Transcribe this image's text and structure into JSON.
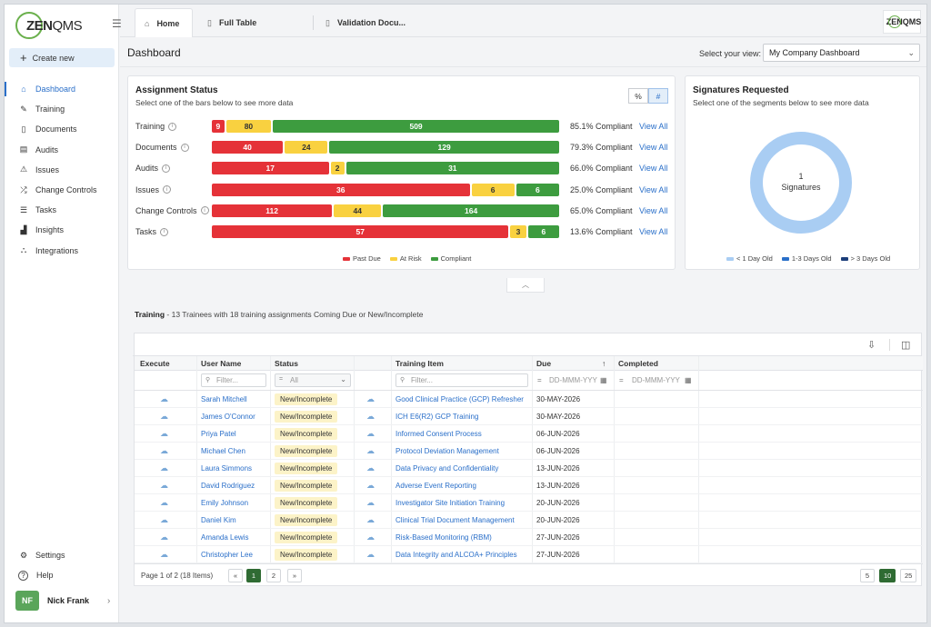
{
  "brand": {
    "logo_text_a": "ZEN",
    "logo_text_b": "QMS",
    "corner_logo": "ZENQMS"
  },
  "sidebar": {
    "create_label": "Create new",
    "items": [
      {
        "label": "Dashboard",
        "icon": "home-icon",
        "active": true
      },
      {
        "label": "Training",
        "icon": "training-icon"
      },
      {
        "label": "Documents",
        "icon": "document-icon"
      },
      {
        "label": "Audits",
        "icon": "audit-icon"
      },
      {
        "label": "Issues",
        "icon": "warning-icon"
      },
      {
        "label": "Change Controls",
        "icon": "shuffle-icon"
      },
      {
        "label": "Tasks",
        "icon": "tasks-icon"
      },
      {
        "label": "Insights",
        "icon": "chart-icon"
      },
      {
        "label": "Integrations",
        "icon": "integrations-icon"
      }
    ],
    "bottom": [
      {
        "label": "Settings",
        "icon": "gear-icon"
      },
      {
        "label": "Help",
        "icon": "help-icon"
      }
    ],
    "user": {
      "initials": "NF",
      "name": "Nick Frank"
    }
  },
  "tabs": [
    {
      "label": "Home",
      "icon": "home-icon"
    },
    {
      "label": "Full Table",
      "icon": "file-icon"
    },
    {
      "label": "Validation Docu...",
      "icon": "file-icon"
    }
  ],
  "header": {
    "title": "Dashboard",
    "view_label": "Select your view:",
    "view_value": "My Company Dashboard"
  },
  "assignment": {
    "title": "Assignment Status",
    "subtitle": "Select one of the bars below to see more data",
    "toggle": [
      "%",
      "#"
    ],
    "view_all": "View All",
    "legend": [
      "Past Due",
      "At Risk",
      "Compliant"
    ],
    "rows": [
      {
        "label": "Training",
        "past_due": 9,
        "at_risk": 80,
        "compliant": 509,
        "pct": "85.1% Compliant"
      },
      {
        "label": "Documents",
        "past_due": 40,
        "at_risk": 24,
        "compliant": 129,
        "pct": "79.3% Compliant"
      },
      {
        "label": "Audits",
        "past_due": 17,
        "at_risk": 2,
        "compliant": 31,
        "pct": "66.0% Compliant"
      },
      {
        "label": "Issues",
        "past_due": 36,
        "at_risk": 6,
        "compliant": 6,
        "pct": "25.0% Compliant"
      },
      {
        "label": "Change Controls",
        "past_due": 112,
        "at_risk": 44,
        "compliant": 164,
        "pct": "65.0% Compliant"
      },
      {
        "label": "Tasks",
        "past_due": 57,
        "at_risk": 3,
        "compliant": 6,
        "pct": "13.6% Compliant"
      }
    ],
    "colors": {
      "past_due": "#e53238",
      "at_risk": "#f9d140",
      "compliant": "#3d9c3f"
    }
  },
  "signatures": {
    "title": "Signatures Requested",
    "subtitle": "Select one of the segments below to see more data",
    "count": "1",
    "count_label": "Signatures",
    "legend": [
      {
        "label": "< 1 Day Old",
        "color": "#a9cdf3"
      },
      {
        "label": "1-3 Days Old",
        "color": "#2a6fc9"
      },
      {
        "label": "> 3 Days Old",
        "color": "#1c3e7a"
      }
    ]
  },
  "training": {
    "title_bold": "Training",
    "title_rest": " - 13 Trainees with 18 training assignments Coming Due or New/Incomplete",
    "columns": [
      "Execute",
      "User Name",
      "Status",
      "Training Item",
      "Due",
      "Completed"
    ],
    "sort_indicator": "↑",
    "filter_placeholder": "Filter...",
    "status_all": "All",
    "date_placeholder": "DD-MMM-YYY",
    "rows": [
      {
        "user": "Sarah Mitchell",
        "status": "New/Incomplete",
        "item": "Good Clinical Practice (GCP) Refresher",
        "due": "30-MAY-2026"
      },
      {
        "user": "James O'Connor",
        "status": "New/Incomplete",
        "item": "ICH E6(R2) GCP Training",
        "due": "30-MAY-2026"
      },
      {
        "user": "Priya Patel",
        "status": "New/Incomplete",
        "item": "Informed Consent Process",
        "due": "06-JUN-2026"
      },
      {
        "user": "Michael Chen",
        "status": "New/Incomplete",
        "item": "Protocol Deviation Management",
        "due": "06-JUN-2026"
      },
      {
        "user": "Laura Simmons",
        "status": "New/Incomplete",
        "item": "Data Privacy and Confidentiality",
        "due": "13-JUN-2026"
      },
      {
        "user": "David Rodriguez",
        "status": "New/Incomplete",
        "item": "Adverse Event Reporting",
        "due": "13-JUN-2026"
      },
      {
        "user": "Emily Johnson",
        "status": "New/Incomplete",
        "item": "Investigator Site Initiation Training",
        "due": "20-JUN-2026"
      },
      {
        "user": "Daniel Kim",
        "status": "New/Incomplete",
        "item": "Clinical Trial Document Management",
        "due": "20-JUN-2026"
      },
      {
        "user": "Amanda Lewis",
        "status": "New/Incomplete",
        "item": "Risk-Based Monitoring (RBM)",
        "due": "27-JUN-2026"
      },
      {
        "user": "Christopher Lee",
        "status": "New/Incomplete",
        "item": "Data Integrity and ALCOA+ Principles",
        "due": "27-JUN-2026"
      }
    ],
    "pager": {
      "info": "Page 1 of 2 (18 Items)",
      "prev": "«",
      "pages": [
        "1",
        "2"
      ],
      "next": "»",
      "sizes": [
        "5",
        "10",
        "25"
      ],
      "current_size": "10",
      "current_page": "1"
    }
  }
}
